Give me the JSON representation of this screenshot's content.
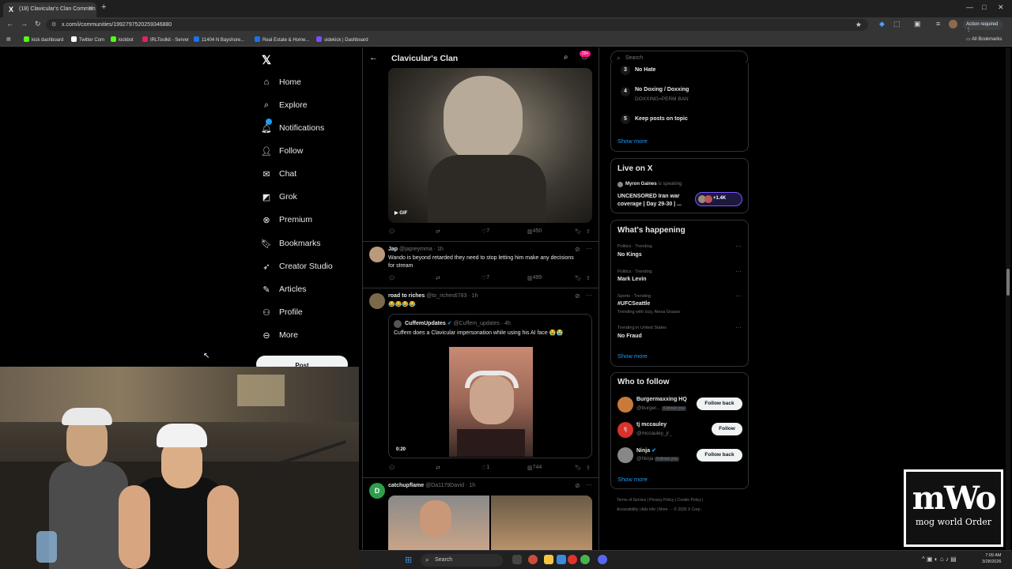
{
  "browser": {
    "tab_title": "(18) Clavicular's Clan Commun",
    "url": "x.com/i/communities/1992797520259346880",
    "action_label": "Action required",
    "bookmarks": [
      {
        "label": "kick dashboard",
        "color": "#53fc18"
      },
      {
        "label": "Twitter Com",
        "color": "#ffffff"
      },
      {
        "label": "kickbot",
        "color": "#53fc18"
      },
      {
        "label": "IRLToolkit - Server",
        "color": "#e0245e"
      },
      {
        "label": "11404 N Bayshore...",
        "color": "#1a73e8"
      },
      {
        "label": "Real Estate & Home...",
        "color": "#1a73e8"
      },
      {
        "label": "sidekick | Dashboard",
        "color": "#7c4dff"
      }
    ],
    "all_bookmarks": "All Bookmarks"
  },
  "nav": {
    "items": [
      {
        "label": "Home",
        "icon": "home-icon"
      },
      {
        "label": "Explore",
        "icon": "search-icon"
      },
      {
        "label": "Notifications",
        "icon": "bell-icon"
      },
      {
        "label": "Follow",
        "icon": "add-user-icon"
      },
      {
        "label": "Chat",
        "icon": "mail-icon"
      },
      {
        "label": "Grok",
        "icon": "grok-icon"
      },
      {
        "label": "Premium",
        "icon": "x-premium-icon"
      },
      {
        "label": "Bookmarks",
        "icon": "bookmark-icon"
      },
      {
        "label": "Creator Studio",
        "icon": "rocket-icon"
      },
      {
        "label": "Articles",
        "icon": "article-icon"
      },
      {
        "label": "Profile",
        "icon": "person-icon"
      },
      {
        "label": "More",
        "icon": "more-circle-icon"
      }
    ],
    "post_label": "Post",
    "notif_badge": "20+"
  },
  "timeline": {
    "title": "Clavicular's Clan",
    "gif_label": "GIF",
    "post1_stats": {
      "likes": "7",
      "views": "450"
    },
    "post2": {
      "name": "Jap",
      "handle": "@japreymma · 1h",
      "text": "Wando is beyond retarded they need to stop letting him make any decisions for stream",
      "likes": "7",
      "views": "499"
    },
    "post3": {
      "name": "road to riches",
      "handle": "@to_riches6783 · 1h",
      "text": "😂😂😂😂",
      "quote": {
        "name": "CuffemUpdates",
        "handle": "@Cuffem_updates · 4h",
        "text": "Cuffem does a Clavicular impersonation while using his AI face 😭😭",
        "duration": "0:20"
      },
      "likes": "1",
      "views": "744"
    },
    "post4": {
      "name": "catchupflame",
      "handle": "@Da1179David · 1h",
      "avatar_letter": "D"
    }
  },
  "right": {
    "search_placeholder": "Search",
    "rules": [
      {
        "no": "3",
        "title": "No Hate",
        "sub": ""
      },
      {
        "no": "4",
        "title": "No Doxing / Doxxing",
        "sub": "DOXXING=PERM BAN"
      },
      {
        "no": "5",
        "title": "Keep posts on topic",
        "sub": ""
      }
    ],
    "show_more": "Show more",
    "live": {
      "title": "Live on X",
      "host": "Myron Gaines",
      "status": "is speaking",
      "text": "UNCENSORED Iran war coverage | Day 29-30 | ...",
      "count": "+1.4K"
    },
    "happening": {
      "title": "What's happening",
      "trends": [
        {
          "meta": "Politics · Trending",
          "name": "No Kings",
          "extra": ""
        },
        {
          "meta": "Politics · Trending",
          "name": "Mark Levin",
          "extra": ""
        },
        {
          "meta": "Sports · Trending",
          "name": "#UFCSeattle",
          "extra": "Trending with Izzy, Alexa Grasso"
        },
        {
          "meta": "Trending in United States",
          "name": "No Fraud",
          "extra": ""
        }
      ]
    },
    "wtf": {
      "title": "Who to follow",
      "users": [
        {
          "name": "Burgermaxxing HQ",
          "handle": "@burger...",
          "tag": "Follows you",
          "button": "Follow back"
        },
        {
          "name": "tj mccauley",
          "handle": "@mccauley_jr_",
          "tag": "",
          "button": "Follow"
        },
        {
          "name": "Ninja",
          "handle": "@Ninja",
          "tag": "Follows you",
          "button": "Follow back"
        }
      ]
    },
    "footer1": "Terms of Service  |  Privacy Policy  |  Cookie Policy  |",
    "footer2": "Accessibility  |  Ads info  |  More ···  © 2026 X Corp."
  },
  "taskbar": {
    "search": "Search",
    "time": "7:09 AM",
    "date": "3/28/2026"
  },
  "logo": {
    "big": "mWo",
    "small": "mog world Order"
  }
}
